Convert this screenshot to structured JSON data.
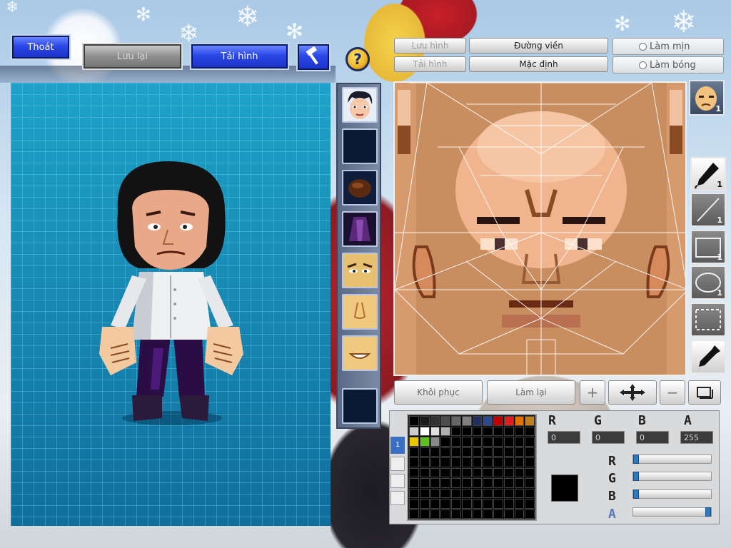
{
  "window": {
    "background_accent": "#1789b5"
  },
  "top_buttons": {
    "exit_label": "Thoát",
    "save_label": "Lưu lại",
    "upload_label": "Tải hình",
    "hammer_icon": "hammer-icon",
    "help_icon": "help-icon",
    "help_glyph": "?"
  },
  "editor_tabs": {
    "save_image": "Lưu hình",
    "upload_image": "Tải hình",
    "outline": "Đường viền",
    "default": "Mặc định",
    "smooth": "Làm mịn",
    "shade": "Làm bóng"
  },
  "parts": [
    {
      "name": "face-portrait",
      "color": "#f0c8a8"
    },
    {
      "name": "empty-slot",
      "color": "#0b1a33"
    },
    {
      "name": "hair-item",
      "color": "#4a2410"
    },
    {
      "name": "outfit-item",
      "color": "#3a1a4a"
    },
    {
      "name": "eyes-item",
      "color": "#e8c070"
    },
    {
      "name": "nose-item",
      "color": "#f0c880"
    },
    {
      "name": "mouth-item",
      "color": "#f0c880"
    },
    {
      "name": "empty-slot-2",
      "color": "#0b1a33"
    }
  ],
  "tools": [
    {
      "name": "pencil-tool",
      "badge": "1",
      "active": true
    },
    {
      "name": "line-tool",
      "badge": "1",
      "active": false
    },
    {
      "name": "rectangle-tool",
      "badge": "1",
      "active": false
    },
    {
      "name": "ellipse-tool",
      "badge": "1",
      "active": false
    },
    {
      "name": "select-tool",
      "badge": "",
      "active": false
    },
    {
      "name": "eyedropper-tool",
      "badge": "",
      "active": false
    }
  ],
  "face_thumb_badge": "1",
  "edit_actions": {
    "restore": "Khôi phục",
    "redo": "Làm lại"
  },
  "color_channels": {
    "r_label": "R",
    "g_label": "G",
    "b_label": "B",
    "a_label": "A",
    "r_value": "0",
    "g_value": "0",
    "b_value": "0",
    "a_value": "255",
    "r_level": 0,
    "g_level": 0,
    "b_level": 0,
    "a_level": 1.0
  },
  "current_color": "#000000",
  "palette_colors": [
    "#000000",
    "#1a1a1a",
    "#333333",
    "#4d4d4d",
    "#666666",
    "#808080",
    "#1f2f5f",
    "#2a4a8a",
    "#c00000",
    "#e02020",
    "#e07000",
    "#c08020",
    "#cccccc",
    "#ffffff",
    "#e0e0e0",
    "#b0b0b0",
    "#000000",
    "#000000",
    "#000000",
    "#000000",
    "#000000",
    "#000000",
    "#000000",
    "#000000",
    "#e8c800",
    "#60c020",
    "#888888",
    "#000000",
    "#000000",
    "#000000",
    "#000000",
    "#000000",
    "#000000",
    "#000000",
    "#000000",
    "#000000"
  ],
  "layer_index": "1"
}
